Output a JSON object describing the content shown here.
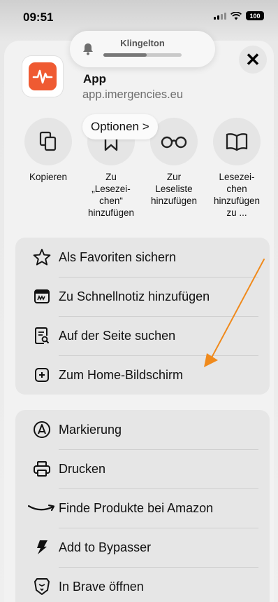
{
  "status_bar": {
    "time": "09:51",
    "battery": "100"
  },
  "ringer": {
    "label": "Klingelton",
    "level": 0.55
  },
  "share_sheet": {
    "app_name": "App",
    "app_url": "app.imergencies.eu",
    "options_label": "Optionen >",
    "close_icon": "close-icon",
    "accent_color": "#ef5a32"
  },
  "actions": [
    {
      "label": "Kopieren",
      "icon": "copy-icon"
    },
    {
      "label": "Zu\n„Lesezei-\nchen“\nhinzufügen",
      "icon": "bookmark-icon"
    },
    {
      "label": "Zur\nLeseliste\nhinzufügen",
      "icon": "glasses-icon"
    },
    {
      "label": "Lesezei-\nchen\nhinzufügen\nzu ...",
      "icon": "book-icon"
    }
  ],
  "group1": [
    {
      "label": "Als Favoriten sichern",
      "icon": "star-icon"
    },
    {
      "label": "Zu Schnellnotiz hinzufügen",
      "icon": "quick-note-icon"
    },
    {
      "label": "Auf der Seite suchen",
      "icon": "find-in-page-icon"
    },
    {
      "label": "Zum Home-Bildschirm",
      "icon": "add-square-icon"
    }
  ],
  "group2": [
    {
      "label": "Markierung",
      "icon": "markup-icon"
    },
    {
      "label": "Drucken",
      "icon": "printer-icon"
    },
    {
      "label": "Finde Produkte bei Amazon",
      "icon": "amazon-icon"
    },
    {
      "label": "Add to Bypasser",
      "icon": "bypasser-icon"
    },
    {
      "label": "In Brave öffnen",
      "icon": "brave-icon"
    }
  ],
  "annotation_color": "#f08a1c"
}
